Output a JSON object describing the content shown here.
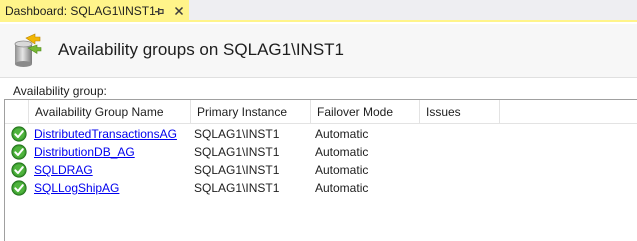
{
  "tab": {
    "title": "Dashboard: SQLAG1\\INST1",
    "pin_glyph": "⊣",
    "close_glyph": "✕"
  },
  "header": {
    "icon": "availability-group-icon",
    "title": "Availability groups on SQLAG1\\INST1"
  },
  "section": {
    "label": "Availability group:"
  },
  "table": {
    "columns": [
      "Availability Group Name",
      "Primary Instance",
      "Failover Mode",
      "Issues"
    ],
    "rows": [
      {
        "name": "DistributedTransactionsAG",
        "primary_instance": "SQLAG1\\INST1",
        "failover_mode": "Automatic",
        "issues": "",
        "status_icon": "healthy-check-icon"
      },
      {
        "name": "DistributionDB_AG",
        "primary_instance": "SQLAG1\\INST1",
        "failover_mode": "Automatic",
        "issues": "",
        "status_icon": "healthy-check-icon"
      },
      {
        "name": "SQLDRAG",
        "primary_instance": "SQLAG1\\INST1",
        "failover_mode": "Automatic",
        "issues": "",
        "status_icon": "healthy-check-icon"
      },
      {
        "name": "SQLLogShipAG",
        "primary_instance": "SQLAG1\\INST1",
        "failover_mode": "Automatic",
        "issues": "",
        "status_icon": "healthy-check-icon"
      }
    ]
  },
  "colors": {
    "tab_active": "#fff48a",
    "link": "#0000ee",
    "healthy": "#3a9a2e"
  }
}
